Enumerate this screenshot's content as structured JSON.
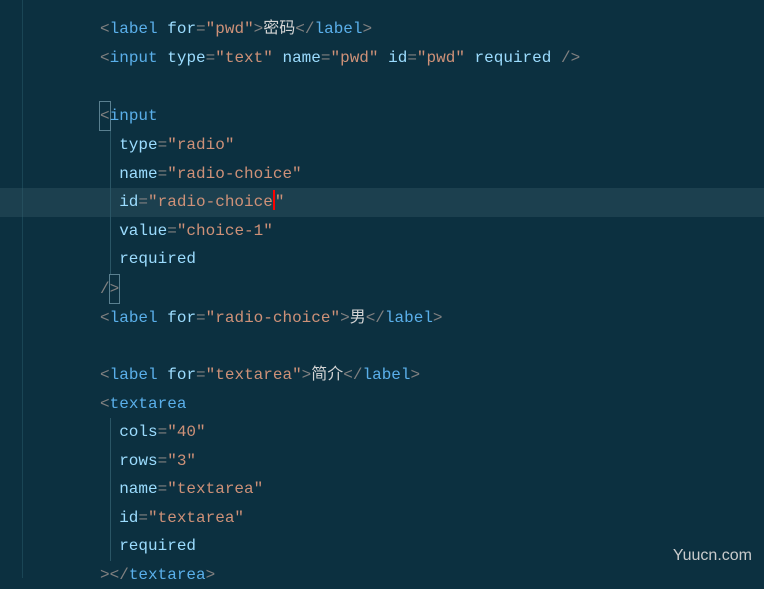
{
  "watermark": "Yuucn.com",
  "lines": [
    {
      "indent": 0,
      "segments": [
        {
          "type": "bracket",
          "text": "<"
        },
        {
          "type": "tag",
          "text": "label"
        },
        {
          "type": "plain",
          "text": " "
        },
        {
          "type": "attr",
          "text": "for"
        },
        {
          "type": "bracket",
          "text": "="
        },
        {
          "type": "value",
          "text": "\"pwd\""
        },
        {
          "type": "bracket",
          "text": ">"
        },
        {
          "type": "content",
          "text": "密码"
        },
        {
          "type": "bracket",
          "text": "</"
        },
        {
          "type": "tag",
          "text": "label"
        },
        {
          "type": "bracket",
          "text": ">"
        }
      ]
    },
    {
      "indent": 0,
      "segments": [
        {
          "type": "bracket",
          "text": "<"
        },
        {
          "type": "tag",
          "text": "input"
        },
        {
          "type": "plain",
          "text": " "
        },
        {
          "type": "attr",
          "text": "type"
        },
        {
          "type": "bracket",
          "text": "="
        },
        {
          "type": "value",
          "text": "\"text\""
        },
        {
          "type": "plain",
          "text": " "
        },
        {
          "type": "attr",
          "text": "name"
        },
        {
          "type": "bracket",
          "text": "="
        },
        {
          "type": "value",
          "text": "\"pwd\""
        },
        {
          "type": "plain",
          "text": " "
        },
        {
          "type": "attr",
          "text": "id"
        },
        {
          "type": "bracket",
          "text": "="
        },
        {
          "type": "value",
          "text": "\"pwd\""
        },
        {
          "type": "plain",
          "text": " "
        },
        {
          "type": "attr",
          "text": "required"
        },
        {
          "type": "plain",
          "text": " "
        },
        {
          "type": "bracket",
          "text": "/>"
        }
      ]
    },
    {
      "indent": 0,
      "segments": []
    },
    {
      "indent": 0,
      "box_start": true,
      "segments": [
        {
          "type": "bracket",
          "text": "<"
        },
        {
          "type": "tag",
          "text": "input"
        }
      ]
    },
    {
      "indent": 1,
      "segments": [
        {
          "type": "attr",
          "text": "type"
        },
        {
          "type": "bracket",
          "text": "="
        },
        {
          "type": "value",
          "text": "\"radio\""
        }
      ]
    },
    {
      "indent": 1,
      "segments": [
        {
          "type": "attr",
          "text": "name"
        },
        {
          "type": "bracket",
          "text": "="
        },
        {
          "type": "value",
          "text": "\"radio-choice\""
        }
      ]
    },
    {
      "indent": 1,
      "highlighted": true,
      "cursor_after_idx": 2,
      "segments": [
        {
          "type": "attr",
          "text": "id"
        },
        {
          "type": "bracket",
          "text": "="
        },
        {
          "type": "value",
          "text": "\"radio-choice"
        },
        {
          "type": "value",
          "text": "\""
        }
      ]
    },
    {
      "indent": 1,
      "segments": [
        {
          "type": "attr",
          "text": "value"
        },
        {
          "type": "bracket",
          "text": "="
        },
        {
          "type": "value",
          "text": "\"choice-1\""
        }
      ]
    },
    {
      "indent": 1,
      "segments": [
        {
          "type": "attr",
          "text": "required"
        }
      ]
    },
    {
      "indent": 0,
      "box_end": true,
      "segments": [
        {
          "type": "bracket",
          "text": "/"
        },
        {
          "type": "bracket",
          "text": ">"
        }
      ]
    },
    {
      "indent": 0,
      "segments": [
        {
          "type": "bracket",
          "text": "<"
        },
        {
          "type": "tag",
          "text": "label"
        },
        {
          "type": "plain",
          "text": " "
        },
        {
          "type": "attr",
          "text": "for"
        },
        {
          "type": "bracket",
          "text": "="
        },
        {
          "type": "value",
          "text": "\"radio-choice\""
        },
        {
          "type": "bracket",
          "text": ">"
        },
        {
          "type": "content",
          "text": "男"
        },
        {
          "type": "bracket",
          "text": "</"
        },
        {
          "type": "tag",
          "text": "label"
        },
        {
          "type": "bracket",
          "text": ">"
        }
      ]
    },
    {
      "indent": 0,
      "segments": []
    },
    {
      "indent": 0,
      "segments": [
        {
          "type": "bracket",
          "text": "<"
        },
        {
          "type": "tag",
          "text": "label"
        },
        {
          "type": "plain",
          "text": " "
        },
        {
          "type": "attr",
          "text": "for"
        },
        {
          "type": "bracket",
          "text": "="
        },
        {
          "type": "value",
          "text": "\"textarea\""
        },
        {
          "type": "bracket",
          "text": ">"
        },
        {
          "type": "content",
          "text": "简介"
        },
        {
          "type": "bracket",
          "text": "</"
        },
        {
          "type": "tag",
          "text": "label"
        },
        {
          "type": "bracket",
          "text": ">"
        }
      ]
    },
    {
      "indent": 0,
      "segments": [
        {
          "type": "bracket",
          "text": "<"
        },
        {
          "type": "tag",
          "text": "textarea"
        }
      ]
    },
    {
      "indent": 1,
      "segments": [
        {
          "type": "attr",
          "text": "cols"
        },
        {
          "type": "bracket",
          "text": "="
        },
        {
          "type": "value",
          "text": "\"40\""
        }
      ]
    },
    {
      "indent": 1,
      "segments": [
        {
          "type": "attr",
          "text": "rows"
        },
        {
          "type": "bracket",
          "text": "="
        },
        {
          "type": "value",
          "text": "\"3\""
        }
      ]
    },
    {
      "indent": 1,
      "segments": [
        {
          "type": "attr",
          "text": "name"
        },
        {
          "type": "bracket",
          "text": "="
        },
        {
          "type": "value",
          "text": "\"textarea\""
        }
      ]
    },
    {
      "indent": 1,
      "segments": [
        {
          "type": "attr",
          "text": "id"
        },
        {
          "type": "bracket",
          "text": "="
        },
        {
          "type": "value",
          "text": "\"textarea\""
        }
      ]
    },
    {
      "indent": 1,
      "segments": [
        {
          "type": "attr",
          "text": "required"
        }
      ]
    },
    {
      "indent": 0,
      "segments": [
        {
          "type": "bracket",
          "text": "></"
        },
        {
          "type": "tag",
          "text": "textarea"
        },
        {
          "type": "bracket",
          "text": ">"
        }
      ]
    }
  ]
}
